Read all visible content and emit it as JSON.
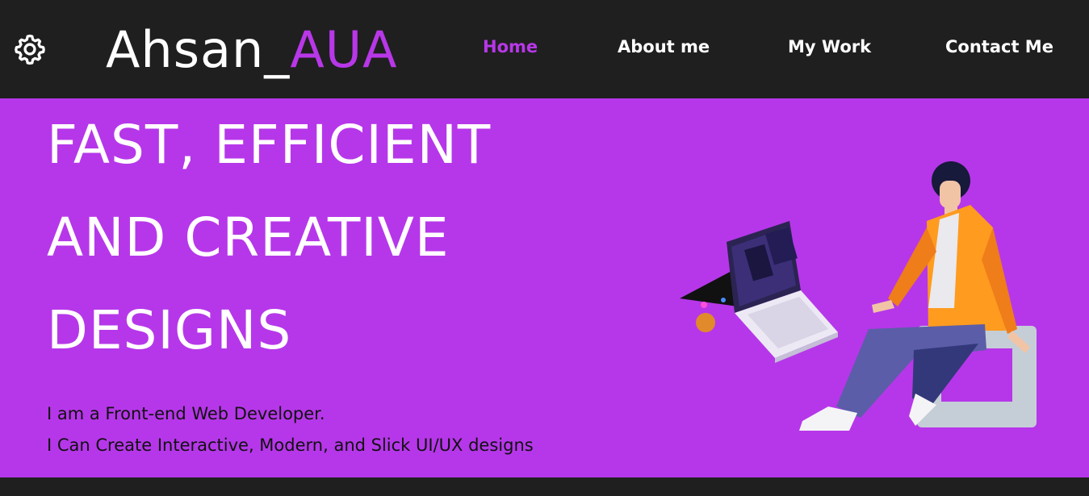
{
  "header": {
    "settings_icon": "gear-icon",
    "logo": {
      "primary": "Ahsan_",
      "accent": "AUA"
    },
    "nav": [
      {
        "label": "Home",
        "active": true
      },
      {
        "label": "About me",
        "active": false
      },
      {
        "label": "My Work",
        "active": false
      },
      {
        "label": "Contact Me",
        "active": false
      }
    ]
  },
  "hero": {
    "headline_lines": [
      "FAST, EFFICIENT",
      "AND CREATIVE",
      "DESIGNS"
    ],
    "tagline_lines": [
      "I am a Front-end Web Developer.",
      "I Can Create Interactive, Modern, and Slick UI/UX designs"
    ],
    "illustration": "developer-with-laptop-illustration"
  },
  "colors": {
    "background_dark": "#1f1f1f",
    "accent_purple": "#b837e8",
    "hero_purple": "#b637e9",
    "text_white": "#ffffff"
  }
}
